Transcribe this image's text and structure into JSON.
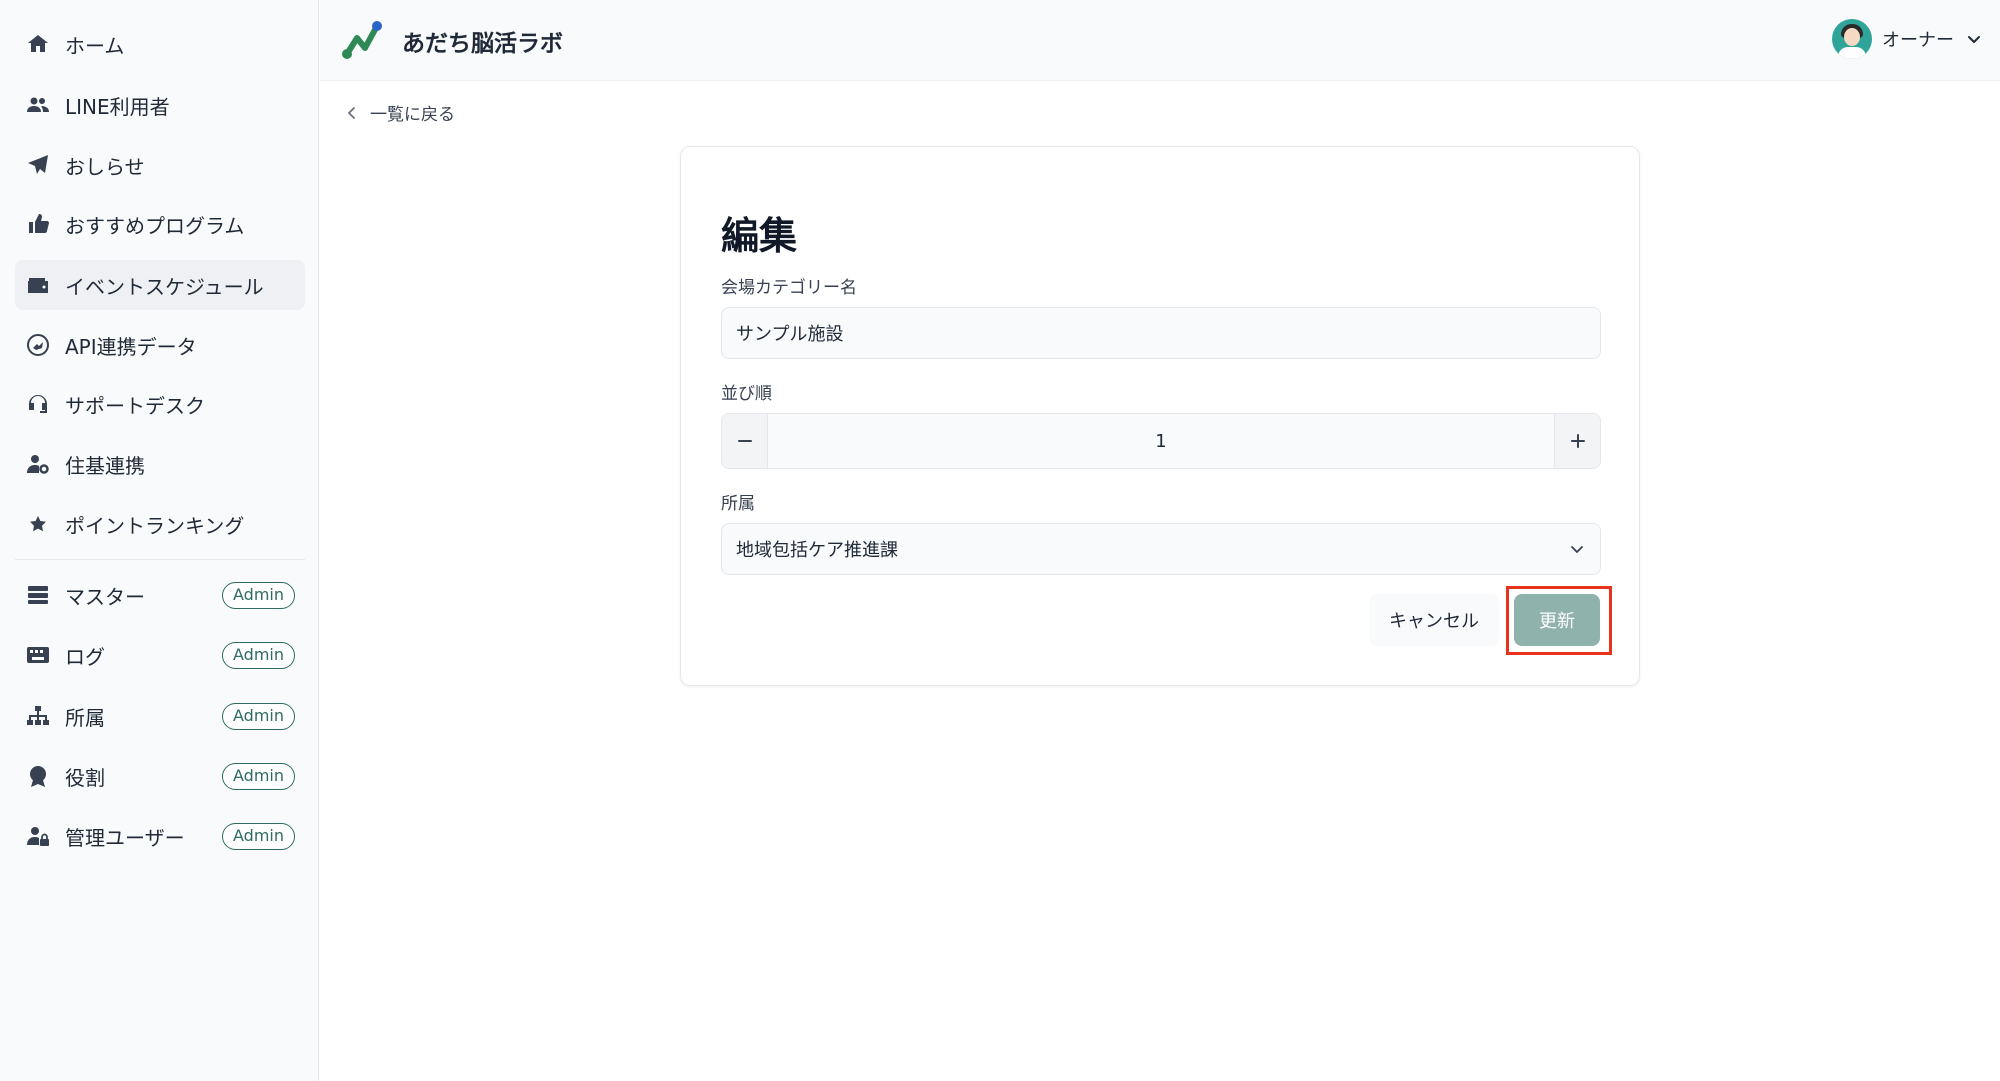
{
  "sidebar": {
    "items": [
      {
        "label": "ホーム",
        "icon": "home-icon"
      },
      {
        "label": "LINE利用者",
        "icon": "users-icon"
      },
      {
        "label": "おしらせ",
        "icon": "paper-plane-icon"
      },
      {
        "label": "おすすめプログラム",
        "icon": "thumbs-up-icon"
      },
      {
        "label": "イベントスケジュール",
        "icon": "wallet-icon",
        "active": true
      },
      {
        "label": "API連携データ",
        "icon": "api-icon"
      },
      {
        "label": "サポートデスク",
        "icon": "headset-icon"
      },
      {
        "label": "住基連携",
        "icon": "user-gear-icon"
      },
      {
        "label": "ポイントランキング",
        "icon": "star-icon"
      }
    ],
    "admin_items": [
      {
        "label": "マスター",
        "icon": "server-icon",
        "badge": "Admin"
      },
      {
        "label": "ログ",
        "icon": "keyboard-icon",
        "badge": "Admin"
      },
      {
        "label": "所属",
        "icon": "sitemap-icon",
        "badge": "Admin"
      },
      {
        "label": "役割",
        "icon": "award-icon",
        "badge": "Admin"
      },
      {
        "label": "管理ユーザー",
        "icon": "user-lock-icon",
        "badge": "Admin"
      }
    ]
  },
  "header": {
    "app_title": "あだち脳活ラボ",
    "user_name": "オーナー"
  },
  "back_link": {
    "label": "一覧に戻る"
  },
  "form": {
    "title": "編集",
    "venue_category_label": "会場カテゴリー名",
    "venue_category_value": "サンプル施設",
    "order_label": "並び順",
    "order_value": "1",
    "affiliation_label": "所属",
    "affiliation_value": "地域包括ケア推進課",
    "cancel_label": "キャンセル",
    "update_label": "更新"
  },
  "colors": {
    "accent": "#2e6b62",
    "update_button": "#8fb2ad",
    "highlight": "#e8321b",
    "sidebar_bg": "#f9fafb"
  }
}
